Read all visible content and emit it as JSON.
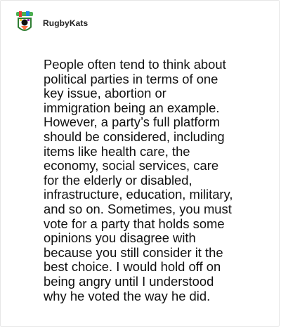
{
  "comment": {
    "username": "RugbyKats",
    "avatar_icon": "rugby-kats-avatar-icon",
    "text": "People often tend to think about\npolitical parties in terms of one\nkey issue, abortion or\nimmigration being an example.\nHowever, a party’s full platform\nshould be considered, including\nitems like health care, the\neconomy, social services, care\nfor the elderly or disabled,\ninfrastructure, education, military,\nand so on. Sometimes, you must\nvote for a party that holds some\nopinions you disagree with\nbecause you still consider it the\nbest choice. I would hold off on\nbeing angry until I understood\nwhy he voted the way he did."
  },
  "colors": {
    "border": "#e6e6e6",
    "text": "#111111",
    "username": "#222222"
  }
}
